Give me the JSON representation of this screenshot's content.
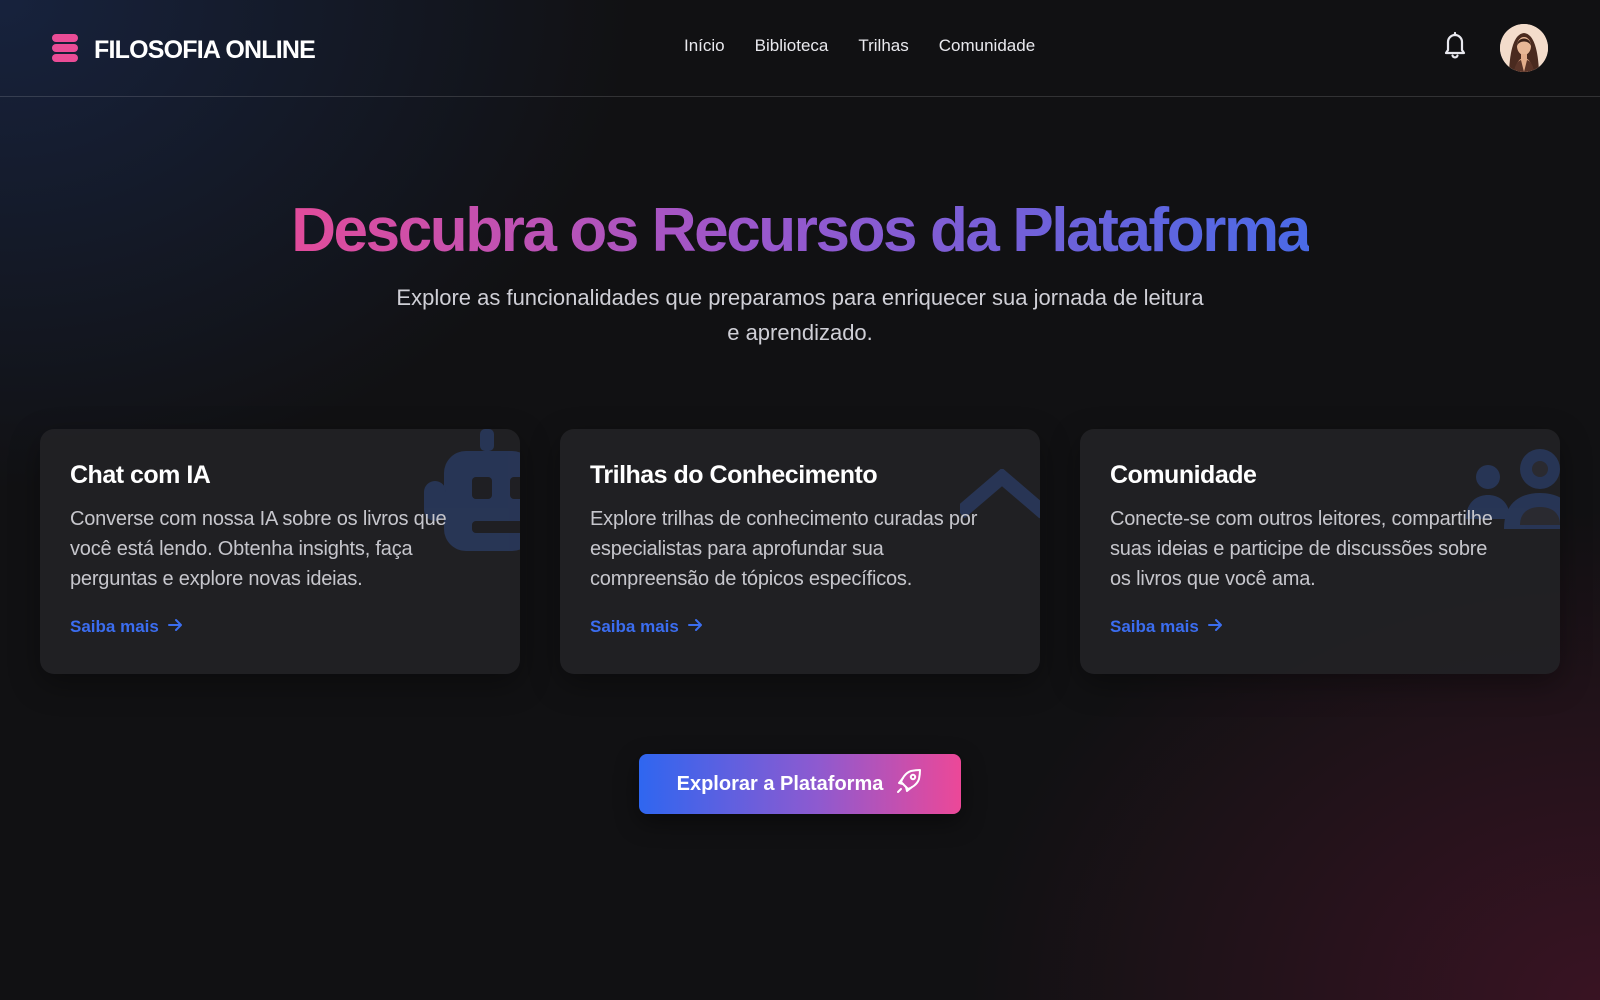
{
  "colors": {
    "accent_blue": "#3b6df0",
    "accent_pink": "#e24c9b",
    "accent_purple": "#9a57cc",
    "background": "#111113"
  },
  "brand": {
    "name": "FILOSOFIA ONLINE",
    "icon": "stacked-layers-icon"
  },
  "nav": {
    "items": [
      {
        "label": "Início"
      },
      {
        "label": "Biblioteca"
      },
      {
        "label": "Trilhas"
      },
      {
        "label": "Comunidade"
      }
    ]
  },
  "header_actions": {
    "notifications_icon": "bell-icon",
    "avatar": "user-avatar"
  },
  "hero": {
    "title": "Descubra os Recursos da Plataforma",
    "subtitle": "Explore as funcionalidades que preparamos para enriquecer sua jornada de leitura e aprendizado."
  },
  "features": [
    {
      "title": "Chat com IA",
      "description": "Converse com nossa IA sobre os livros que você está lendo. Obtenha insights, faça perguntas e explore novas ideias.",
      "link": "Saiba mais",
      "icon": "robot-icon"
    },
    {
      "title": "Trilhas do Conhecimento",
      "description": "Explore trilhas de conhecimento curadas por especialistas para aprofundar sua compreensão de tópicos específicos.",
      "link": "Saiba mais",
      "icon": "chevron-up-icon"
    },
    {
      "title": "Comunidade",
      "description": "Conecte-se com outros leitores, compartilhe suas ideias e participe de discussões sobre os livros que você ama.",
      "link": "Saiba mais",
      "icon": "users-icon"
    }
  ],
  "cta": {
    "label": "Explorar a Plataforma",
    "icon": "rocket-icon"
  }
}
